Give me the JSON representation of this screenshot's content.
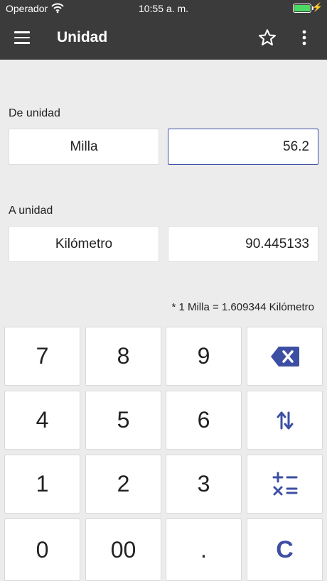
{
  "status": {
    "carrier": "Operador",
    "time": "10:55 a. m."
  },
  "app_bar": {
    "title": "Unidad"
  },
  "from": {
    "label": "De unidad",
    "unit": "Milla",
    "value": "56.2"
  },
  "to": {
    "label": "A unidad",
    "unit": "Kilómetro",
    "value": "90.445133"
  },
  "formula": "* 1 Milla = 1.609344 Kilómetro",
  "keypad": {
    "digits": [
      "7",
      "8",
      "9",
      "4",
      "5",
      "6",
      "1",
      "2",
      "3",
      "0",
      "00",
      "."
    ],
    "clear_label": "C"
  },
  "colors": {
    "app_bar": "#3b3b3b",
    "accent": "#3d4fa3",
    "background": "#ececec"
  }
}
